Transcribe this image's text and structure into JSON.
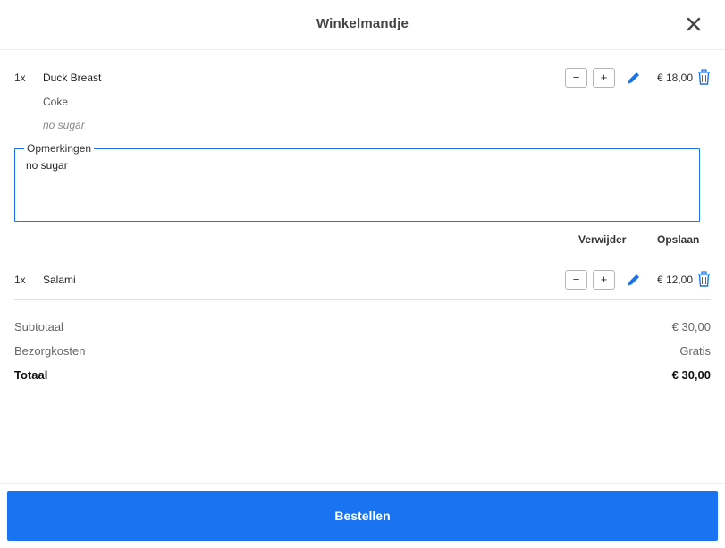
{
  "header": {
    "title": "Winkelmandje",
    "close_icon": "close-icon"
  },
  "items": [
    {
      "qty": "1x",
      "name": "Duck Breast",
      "minus": "−",
      "plus": "+",
      "price": "€ 18,00",
      "details": [
        "Coke",
        "no sugar"
      ]
    },
    {
      "qty": "1x",
      "name": "Salami",
      "minus": "−",
      "plus": "+",
      "price": "€ 12,00"
    }
  ],
  "remarks": {
    "label": "Opmerkingen",
    "value": "no sugar"
  },
  "actions": {
    "delete": "Verwijder",
    "save": "Opslaan"
  },
  "summary": {
    "subtotal_label": "Subtotaal",
    "subtotal_value": "€ 30,00",
    "delivery_label": "Bezorgkosten",
    "delivery_value": "Gratis",
    "total_label": "Totaal",
    "total_value": "€ 30,00"
  },
  "order_button": "Bestellen",
  "colors": {
    "accent": "#1a73f0",
    "icon_blue": "#1a73e8"
  }
}
